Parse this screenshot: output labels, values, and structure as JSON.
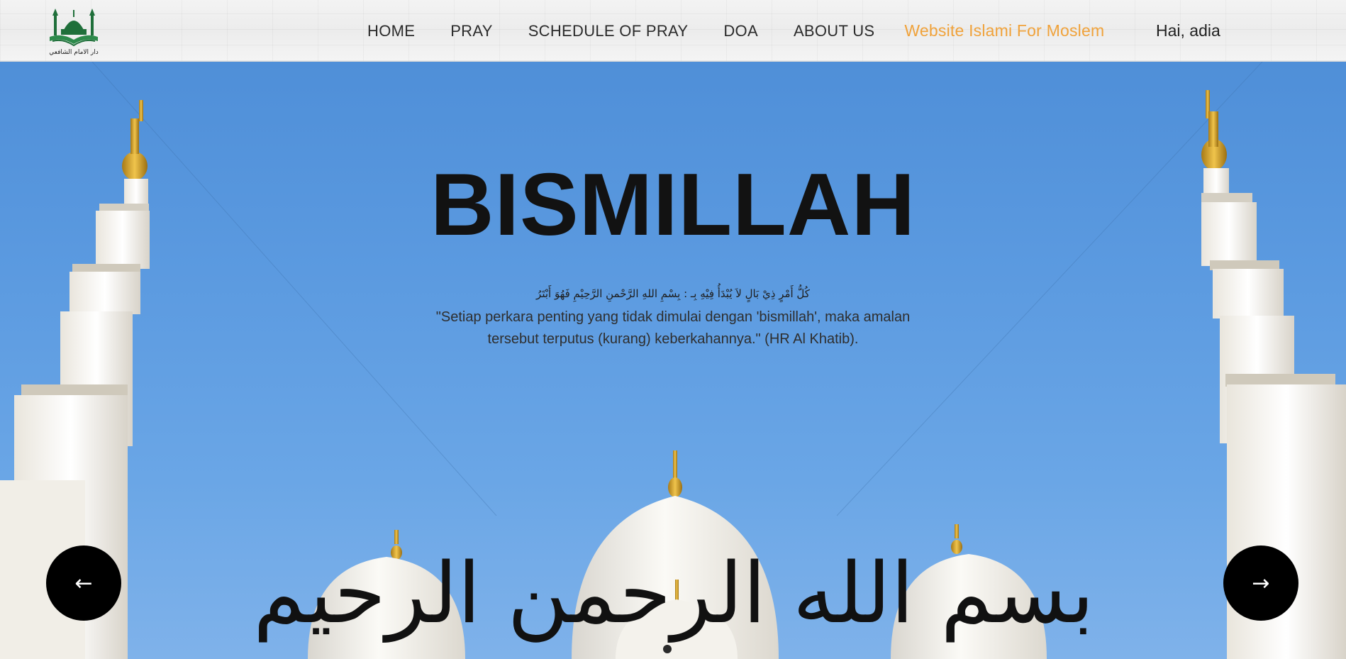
{
  "header": {
    "logo_icon": "mosque-logo-icon",
    "logo_caption": "دار الامام الشافعي",
    "nav": [
      "HOME",
      "PRAY",
      "SCHEDULE OF PRAY",
      "DOA",
      "ABOUT US"
    ],
    "brand": "Website Islami For Moslem",
    "user_greeting": "Hai, adia"
  },
  "hero": {
    "title": "BISMILLAH",
    "arabic_hadith": "كُلُّ أَمْرٍ ذِيْ بَالٍ لاَ يُبْدَأُ فِيْهِ بِـ : بِسْمِ اللهِ الرَّحْمنِ الرَّحِيْمِ فَهُوَ أَبْتَرُ",
    "quote": "\"Setiap perkara penting yang tidak dimulai dengan 'bismillah', maka amalan tersebut terputus (kurang) keberkahannya.\" (HR Al Khatib).",
    "calligraphy": "بسم الله الرحمن الرحيم",
    "prev_icon": "arrow-left-icon",
    "next_icon": "arrow-right-icon",
    "prev_glyph": "←",
    "next_glyph": "→"
  },
  "colors": {
    "brand_accent": "#f0a23a",
    "sky": "#5b9ae0",
    "logo_green": "#1f6f3a"
  }
}
